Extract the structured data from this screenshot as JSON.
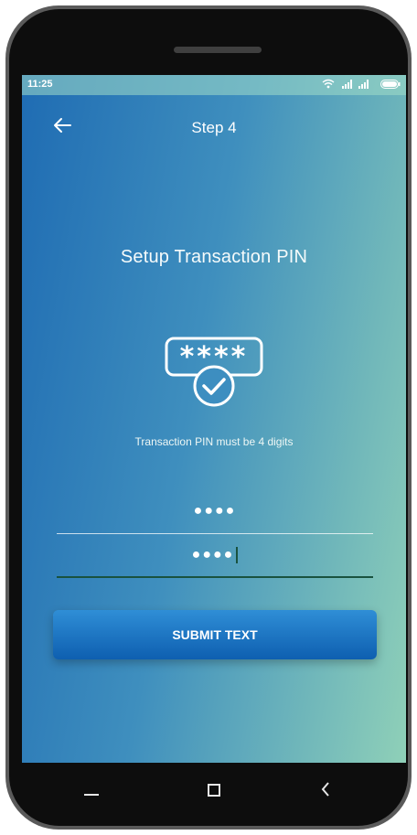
{
  "status_bar": {
    "time": "11:25"
  },
  "header": {
    "step_label": "Step 4"
  },
  "main": {
    "title": "Setup Transaction PIN",
    "pin_icon_text": "* * * *",
    "hint": "Transaction PIN must be 4 digits",
    "pin_field_value": "●●●●",
    "confirm_pin_field_value": "●●●●"
  },
  "submit_button": {
    "label": "SUBMIT TEXT"
  },
  "colors": {
    "gradient_start": "#1f6cb3",
    "gradient_end": "#8fd0b8",
    "button": "#1a70c0",
    "active_line": "#19523f"
  },
  "icons": [
    "wifi-icon",
    "signal-icon",
    "battery-icon",
    "back-arrow-icon",
    "pin-check-icon",
    "nav-back-icon",
    "nav-home-icon",
    "nav-recents-icon"
  ]
}
